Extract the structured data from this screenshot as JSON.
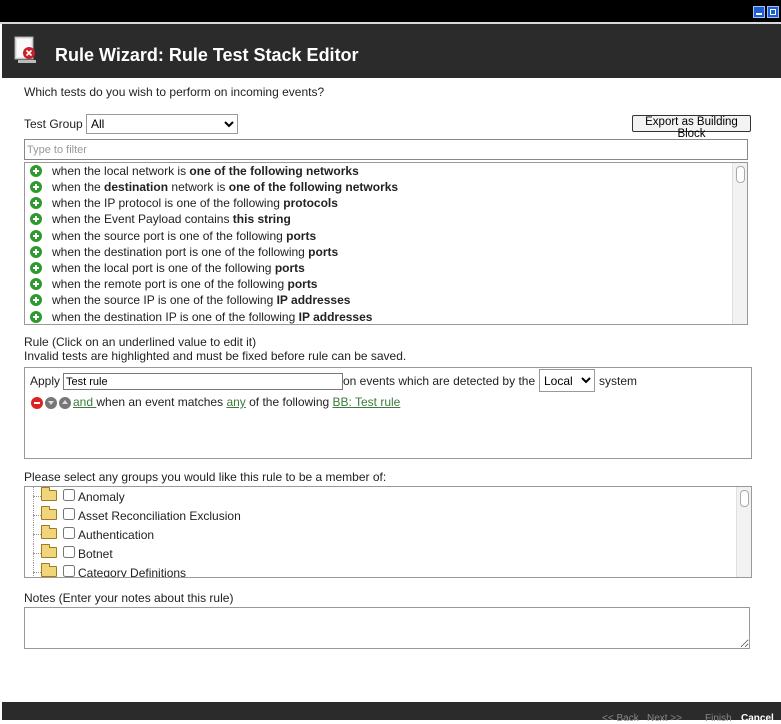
{
  "window": {
    "title": "Rule Wizard: Rule Test Stack Editor"
  },
  "question": "Which tests do you wish to perform on incoming events?",
  "test_group": {
    "label": "Test Group",
    "selected": "All"
  },
  "export_button": "Export as Building Block",
  "filter": {
    "placeholder": "Type to filter",
    "value": ""
  },
  "tests": [
    {
      "prefix": "when the local network is ",
      "strong": "one of the following networks",
      "suffix": ""
    },
    {
      "prefix": "when the ",
      "strong": "destination",
      "suffix": " network is ",
      "strong2": "one of the following networks"
    },
    {
      "prefix": "when the IP protocol is one of the following ",
      "strong": "protocols",
      "suffix": ""
    },
    {
      "prefix": "when the Event Payload contains ",
      "strong": "this string",
      "suffix": ""
    },
    {
      "prefix": "when the source port is one of the following ",
      "strong": "ports",
      "suffix": ""
    },
    {
      "prefix": "when the destination port is one of the following ",
      "strong": "ports",
      "suffix": ""
    },
    {
      "prefix": "when the local port is one of the following ",
      "strong": "ports",
      "suffix": ""
    },
    {
      "prefix": "when the remote port is one of the following ",
      "strong": "ports",
      "suffix": ""
    },
    {
      "prefix": "when the source IP is one of the following ",
      "strong": "IP addresses",
      "suffix": ""
    },
    {
      "prefix": "when the destination IP is one of the following ",
      "strong": "IP addresses",
      "suffix": ""
    }
  ],
  "rule_section": {
    "title": "Rule (Click on an underlined value to edit it)",
    "note": "Invalid tests are highlighted and must be fixed before rule can be saved.",
    "apply_label": "Apply",
    "rule_name": "Test rule",
    "detected_label": "on events which are detected by the",
    "location": "Local",
    "system_label": "system",
    "line": {
      "and": " and ",
      "text1": "when an event matches ",
      "any": "any",
      "text2": " of the following ",
      "bb": "BB: Test rule"
    }
  },
  "groups_prompt": "Please select any groups you would like this rule to be a member of:",
  "groups": [
    "Anomaly",
    "Asset Reconciliation Exclusion",
    "Authentication",
    "Botnet",
    "Category Definitions"
  ],
  "notes": {
    "label": "Notes (Enter your notes about this rule)",
    "value": ""
  },
  "footer": {
    "back": "<< Back",
    "next": "Next >>",
    "finish": "Finish",
    "cancel": "Cancel"
  }
}
